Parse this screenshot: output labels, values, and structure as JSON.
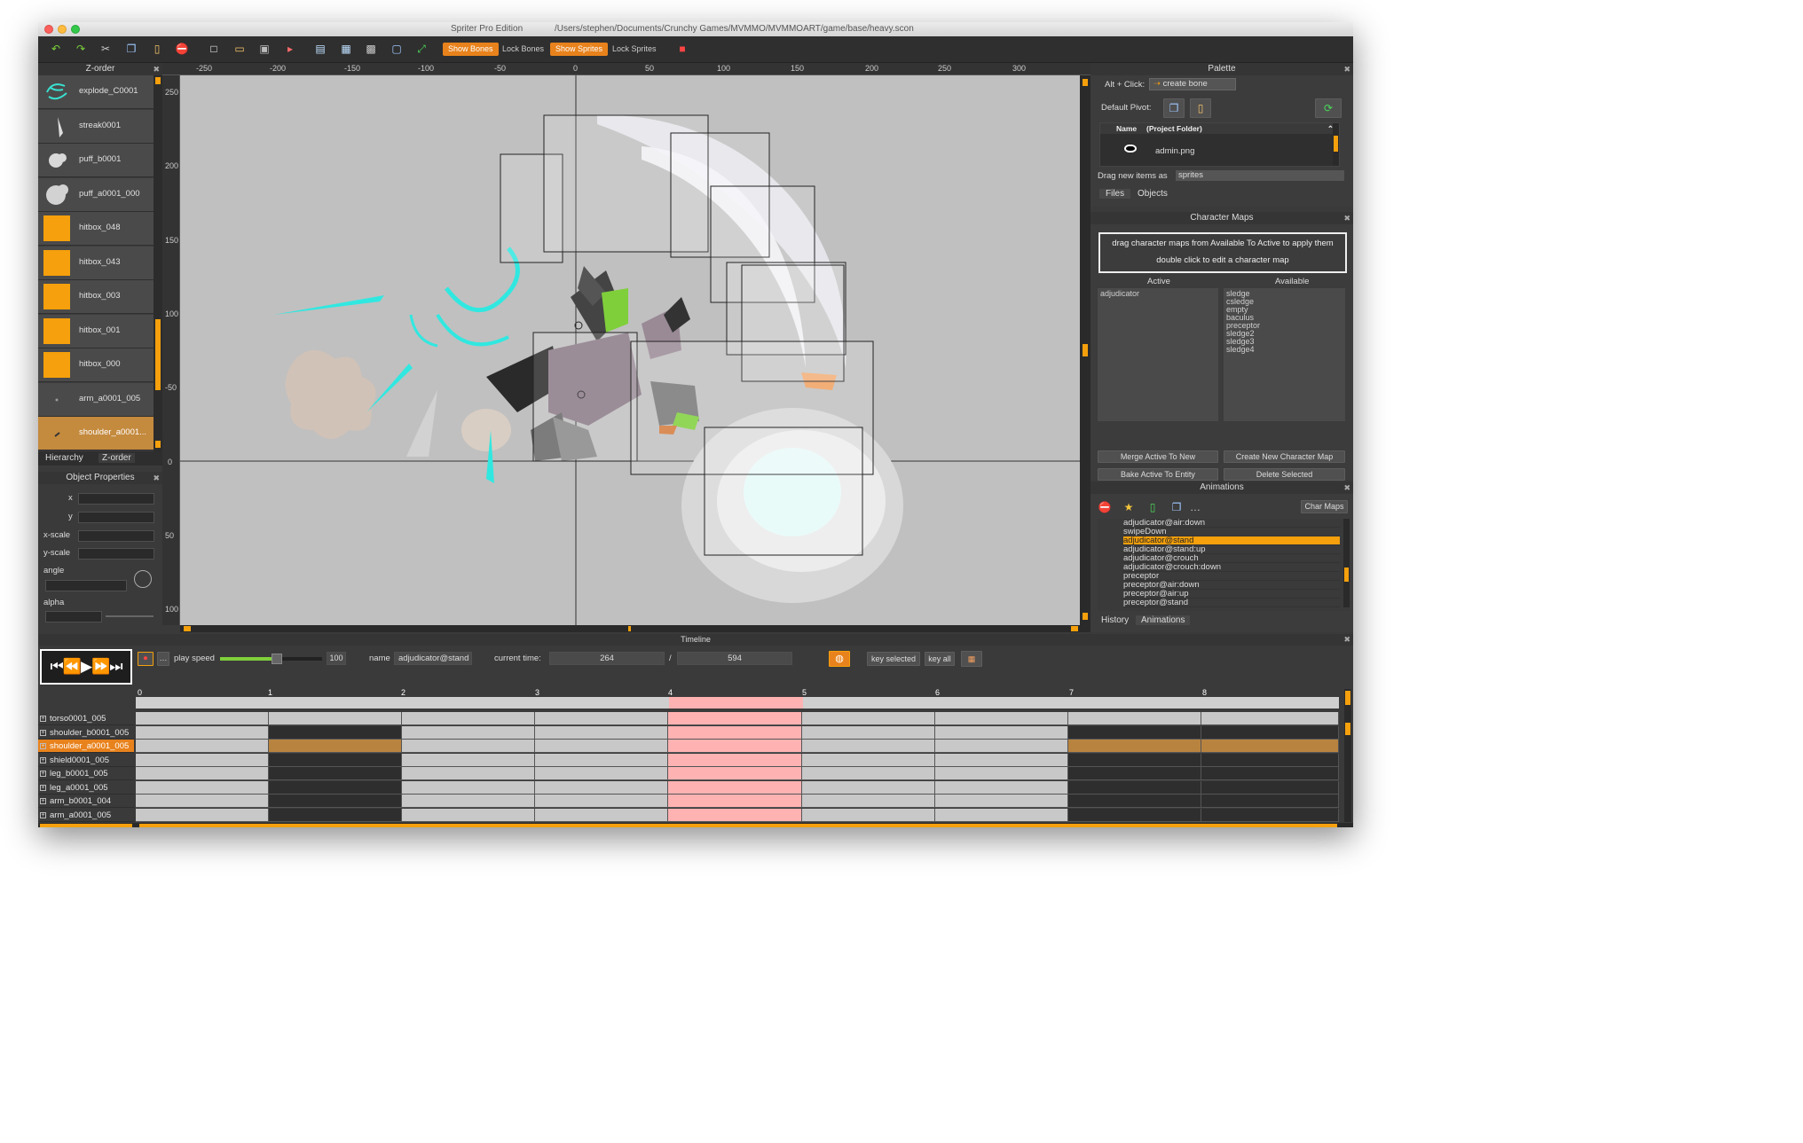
{
  "window": {
    "app_title": "Spriter Pro Edition",
    "file_path": "/Users/stephen/Documents/Crunchy Games/MVMMO/MVMMOART/game/base/heavy.scon"
  },
  "toolbar": {
    "show_bones": "Show Bones",
    "lock_bones": "Lock Bones",
    "show_sprites": "Show Sprites",
    "lock_sprites": "Lock Sprites"
  },
  "zorder": {
    "title": "Z-order",
    "items": [
      "explode_C0001",
      "streak0001",
      "puff_b0001",
      "puff_a0001_000",
      "hitbox_048",
      "hitbox_043",
      "hitbox_003",
      "hitbox_001",
      "hitbox_000",
      "arm_a0001_005",
      "shoulder_a0001..."
    ],
    "tabs": [
      "Hierarchy",
      "Z-order"
    ]
  },
  "object_properties": {
    "title": "Object Properties",
    "labels": [
      "x",
      "y",
      "x-scale",
      "y-scale",
      "angle",
      "alpha"
    ]
  },
  "canvas": {
    "hruler": [
      "-250",
      "-200",
      "-150",
      "-100",
      "-50",
      "0",
      "50",
      "100",
      "150",
      "200",
      "250",
      "300"
    ],
    "vruler": [
      "250",
      "200",
      "150",
      "100",
      "-50",
      "0",
      "50",
      "100"
    ]
  },
  "palette": {
    "title": "Palette",
    "alt_click": "Alt + Click:",
    "create_bone": "create bone",
    "default_pivot": "Default Pivot:",
    "col_name": "Name",
    "col_folder": "(Project Folder)",
    "file": "admin.png",
    "drag_new": "Drag new items as",
    "drag_mode": "sprites",
    "tabs": [
      "Files",
      "Objects"
    ]
  },
  "character_maps": {
    "title": "Character Maps",
    "hint1": "drag character maps from Available To Active to apply them",
    "hint2": "double click to edit a character map",
    "active_label": "Active",
    "available_label": "Available",
    "active": [
      "adjudicator"
    ],
    "available": [
      "sledge",
      "csledge",
      "empty",
      "baculus",
      "preceptor",
      "sledge2",
      "sledge3",
      "sledge4"
    ],
    "buttons": [
      "Merge Active To New",
      "Create New Character Map",
      "Bake Active To Entity",
      "Delete Selected"
    ]
  },
  "animations": {
    "title": "Animations",
    "char_maps": "Char Maps",
    "items": [
      "adjudicator@air:down",
      "swipeDown",
      "adjudicator@stand",
      "adjudicator@stand:up",
      "adjudicator@crouch",
      "adjudicator@crouch:down",
      "preceptor",
      "preceptor@air:down",
      "preceptor@air:up",
      "preceptor@stand"
    ],
    "selected_index": 2,
    "tabs": [
      "History",
      "Animations"
    ]
  },
  "timeline": {
    "title": "Timeline",
    "play_speed_label": "play speed",
    "play_speed": "100",
    "play_speed_fraction": 0.5,
    "name_label": "name",
    "name": "adjudicator@stand",
    "current_time_label": "current time:",
    "current_time": "264",
    "slash": "/",
    "length": "594",
    "key_selected": "key selected",
    "key_all": "key all",
    "ticks": [
      "0",
      "1",
      "2",
      "3",
      "4",
      "5",
      "6",
      "7",
      "8"
    ],
    "rows": [
      "torso0001_005",
      "shoulder_b0001_005",
      "shoulder_a0001_005",
      "shield0001_005",
      "leg_b0001_005",
      "leg_a0001_005",
      "arm_b0001_004",
      "arm_a0001_005"
    ],
    "selected_row": 2
  },
  "colors": {
    "accent": "#f5a00c",
    "highlight": "#ffb2b2",
    "canvas": "#c0c0c0"
  }
}
